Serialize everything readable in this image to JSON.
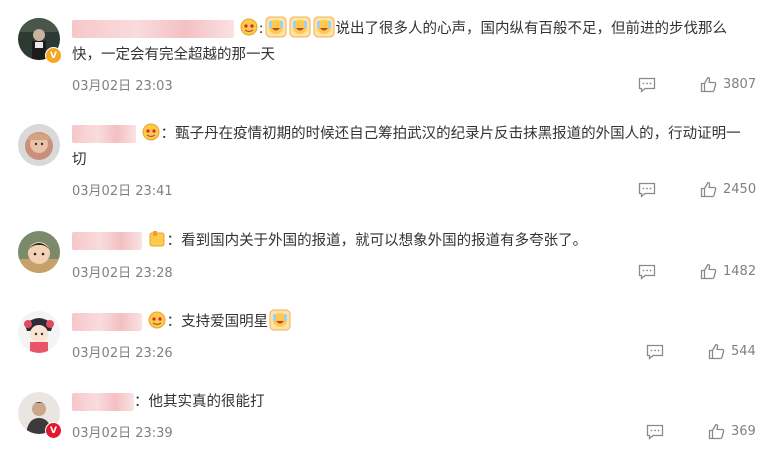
{
  "comments": [
    {
      "text": "说出了很多人的心声，国内纵有百般不足，但前进的步伐那么快，一定会有完全超越的那一天",
      "text_line1": "说出了很多人的心声，国内纵有百般不足，但前进的步伐那么",
      "text_line2": "快，一定会有完全超越的那一天",
      "time": "03月02日 23:03",
      "likes": "3807",
      "badge": "V"
    },
    {
      "text": "：甄子丹在疫情初期的时候还自己筹拍武汉的纪录片反击抹黑报道的外国人的，行动证明一切",
      "text_line1": "：甄子丹在疫情初期的时候还自己筹拍武汉的纪录片反击抹黑报道的外国人的，行动证明一",
      "text_line2": "切",
      "time": "03月02日 23:41",
      "likes": "2450"
    },
    {
      "text": "：看到国内关于外国的报道，就可以想象外国的报道有多夸张了。",
      "time": "03月02日 23:28",
      "likes": "1482"
    },
    {
      "text": "：支持爱国明星",
      "time": "03月02日 23:26",
      "likes": "544"
    },
    {
      "text": "：他其实真的很能打",
      "time": "03月02日 23:39",
      "likes": "369",
      "badge": "V"
    }
  ],
  "colors": {
    "text": "#333333",
    "meta": "#808080",
    "badge_orange": "#f5a623",
    "badge_red": "#e6162d",
    "username_blur": "#f6c7c9"
  },
  "icons": {
    "reply": "reply-icon",
    "like": "thumbs-up-icon",
    "emoji": "emoji-icon"
  }
}
